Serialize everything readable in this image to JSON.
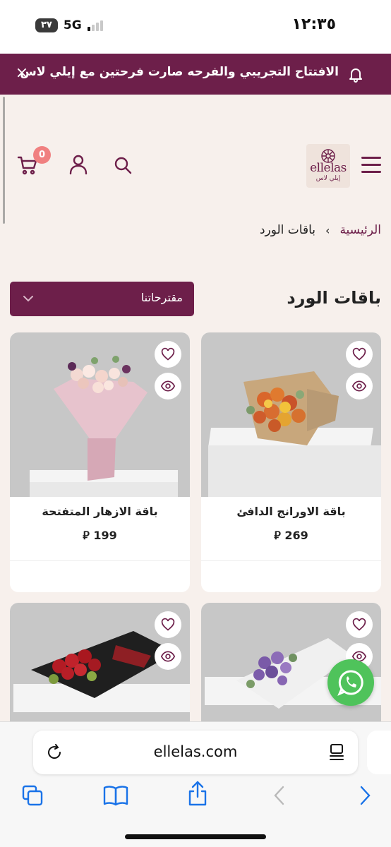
{
  "status_bar": {
    "time": "١٢:٣٥",
    "network": "5G",
    "battery": "٣٧"
  },
  "announcement": {
    "text": "الافتتاح التجريبي والفرحه صارت فرحتين مع إيلي لاس",
    "close_label": "×",
    "icon": "bell-icon"
  },
  "header": {
    "logo_text": "ellelas",
    "logo_subtext": "إيلي لاس",
    "cart_count": "0",
    "icons": [
      "menu-icon",
      "search-icon",
      "user-icon",
      "cart-icon"
    ]
  },
  "breadcrumb": {
    "home": "الرئيسية",
    "separator": "›",
    "current": "باقات الورد"
  },
  "page": {
    "title": "باقات الورد",
    "sort_label": "مقترحاتنا"
  },
  "products": [
    {
      "name": "باقة الاورانج الدافئ",
      "price": "269 ⃁"
    },
    {
      "name": "باقة الازهار المتفتحة",
      "price": "199 ⃁"
    },
    {
      "name": "",
      "price": ""
    },
    {
      "name": "",
      "price": ""
    }
  ],
  "browser": {
    "url": "ellelas.com"
  },
  "colors": {
    "brand": "#6d1f4a",
    "background": "#f7f0ec",
    "badge": "#f08080",
    "whatsapp": "#4fc35b",
    "link": "#1a73e8"
  }
}
